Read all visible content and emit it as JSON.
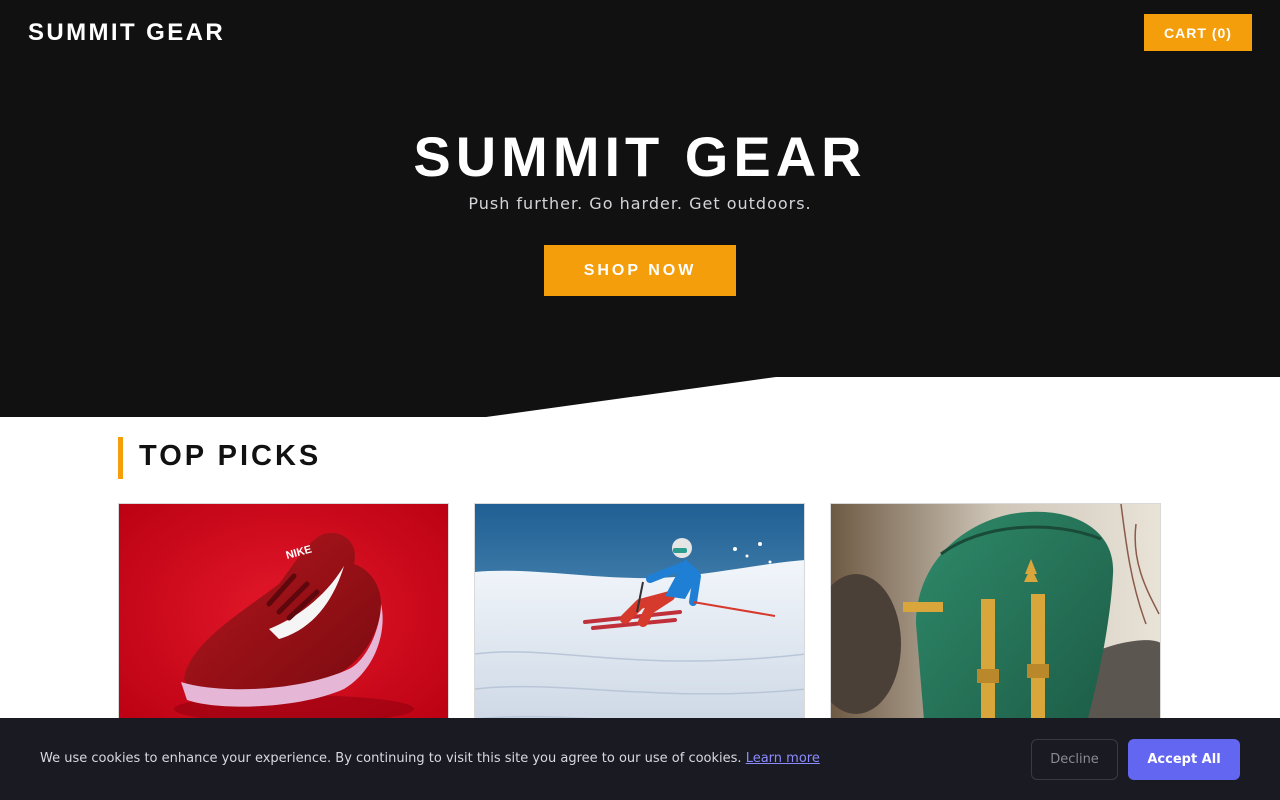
{
  "header": {
    "brand": "SUMMIT GEAR",
    "cart_label": "CART (0)"
  },
  "hero": {
    "title": "SUMMIT GEAR",
    "subtitle": "Push further. Go harder. Get outdoors.",
    "cta_label": "SHOP NOW"
  },
  "section": {
    "title": "TOP PICKS"
  },
  "products": [
    {
      "image": "red-running-shoe"
    },
    {
      "image": "skier-on-slope"
    },
    {
      "image": "green-backpack"
    }
  ],
  "cookie": {
    "message": "We use cookies to enhance your experience. By continuing to visit this site you agree to our use of cookies.",
    "link_label": "Learn more",
    "decline_label": "Decline",
    "accept_label": "Accept All"
  },
  "colors": {
    "hero_bg": "#111112",
    "accent": "#f59e0b",
    "cookie_bg": "#1a1a22",
    "accept_bg": "#6366f1"
  }
}
